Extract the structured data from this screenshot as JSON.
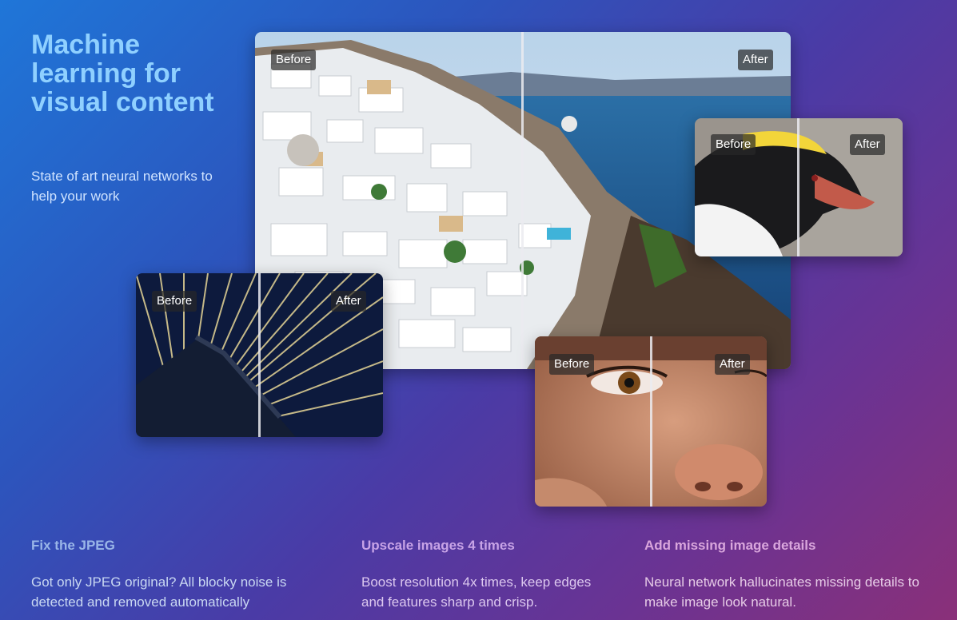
{
  "hero": {
    "title": "Machine learning for visual content",
    "subtitle": "State of art neural networks to help your work"
  },
  "labels": {
    "before": "Before",
    "after": "After"
  },
  "features": [
    {
      "title": "Fix the JPEG",
      "description": "Got only JPEG original? All blocky noise is detected and removed automatically",
      "color": "#9ab6e8"
    },
    {
      "title": "Upscale images 4 times",
      "description": "Boost resolution 4x times, keep edges and features sharp and crisp.",
      "color": "#c7a3e6"
    },
    {
      "title": "Add missing image details",
      "description": "Neural network hallucinates missing details to make image look natural.",
      "color": "#d9a6dc"
    }
  ]
}
